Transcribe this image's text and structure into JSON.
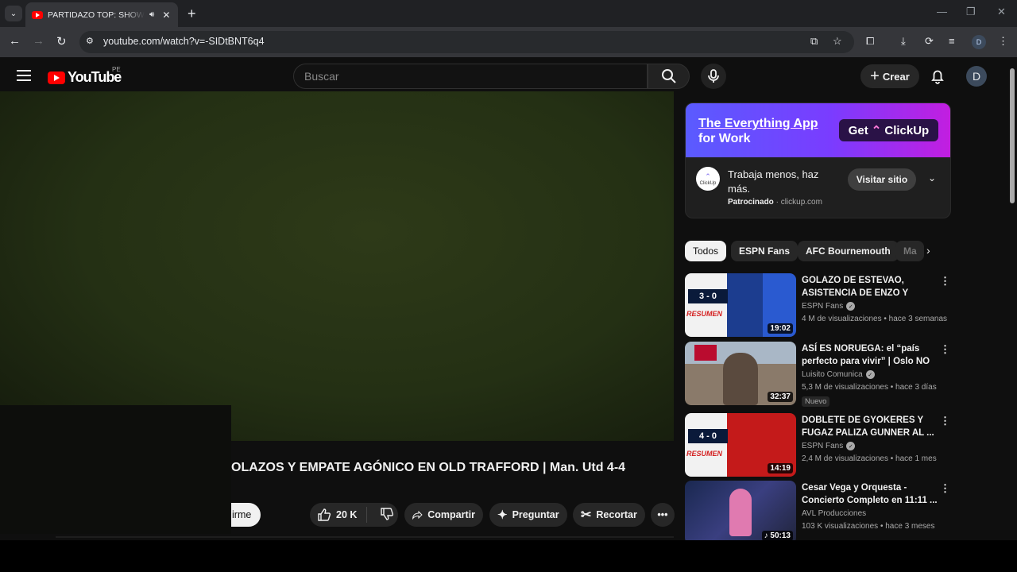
{
  "browser": {
    "tab_title": "PARTIDAZO TOP: SHOW DE",
    "url": "youtube.com/watch?v=-SIDtBNT6q4",
    "profile_initial": "D"
  },
  "header": {
    "logo_text": "YouTube",
    "country": "PE",
    "search_placeholder": "Buscar",
    "create_label": "Crear",
    "avatar_initial": "D"
  },
  "video": {
    "title": "OLAZOS Y EMPATE AGÓNICO EN OLD TRAFFORD | Man. Utd 4-4",
    "subscribe_label": "irme",
    "likes": "20 K",
    "share_label": "Compartir",
    "ask_label": "Preguntar",
    "clip_label": "Recortar"
  },
  "ad": {
    "banner_line1": "The Everything App",
    "banner_line2": "for Work",
    "banner_button": "Get",
    "banner_brand": "ClickUp",
    "logo_text": "ClickUp",
    "headline": "Trabaja menos, haz más.",
    "sponsored": "Patrocinado",
    "domain": "clickup.com",
    "visit_label": "Visitar sitio"
  },
  "chips": [
    "Todos",
    "ESPN Fans",
    "AFC Bournemouth",
    "Ma"
  ],
  "recommendations": [
    {
      "title": "GOLAZO DE ESTEVAO, ASISTENCIA DE ENZO Y PALIZ...",
      "channel": "ESPN Fans",
      "verified": true,
      "meta": "4 M de visualizaciones • hace 3 semanas",
      "duration": "19:02",
      "badge": ""
    },
    {
      "title": "ASÍ ES NORUEGA: el “país perfecto para vivir” | Oslo NO",
      "channel": "Luisito Comunica",
      "verified": true,
      "meta": "5,3 M de visualizaciones • hace 3 días",
      "duration": "32:37",
      "badge": "Nuevo"
    },
    {
      "title": "DOBLETE DE GYOKERES Y FUGAZ PALIZA GUNNER AL ...",
      "channel": "ESPN Fans",
      "verified": true,
      "meta": "2,4 M de visualizaciones • hace 1 mes",
      "duration": "14:19",
      "badge": ""
    },
    {
      "title": "Cesar Vega y Orquesta - Concierto Completo en 11:11 ...",
      "channel": "AVL Producciones",
      "verified": false,
      "meta": "103 K visualizaciones • hace 3 meses",
      "duration": "50:13",
      "badge": ""
    }
  ],
  "thumb_text": {
    "score1": "3 - 0",
    "score3": "4 - 0",
    "resumen": "RESUMEN"
  }
}
